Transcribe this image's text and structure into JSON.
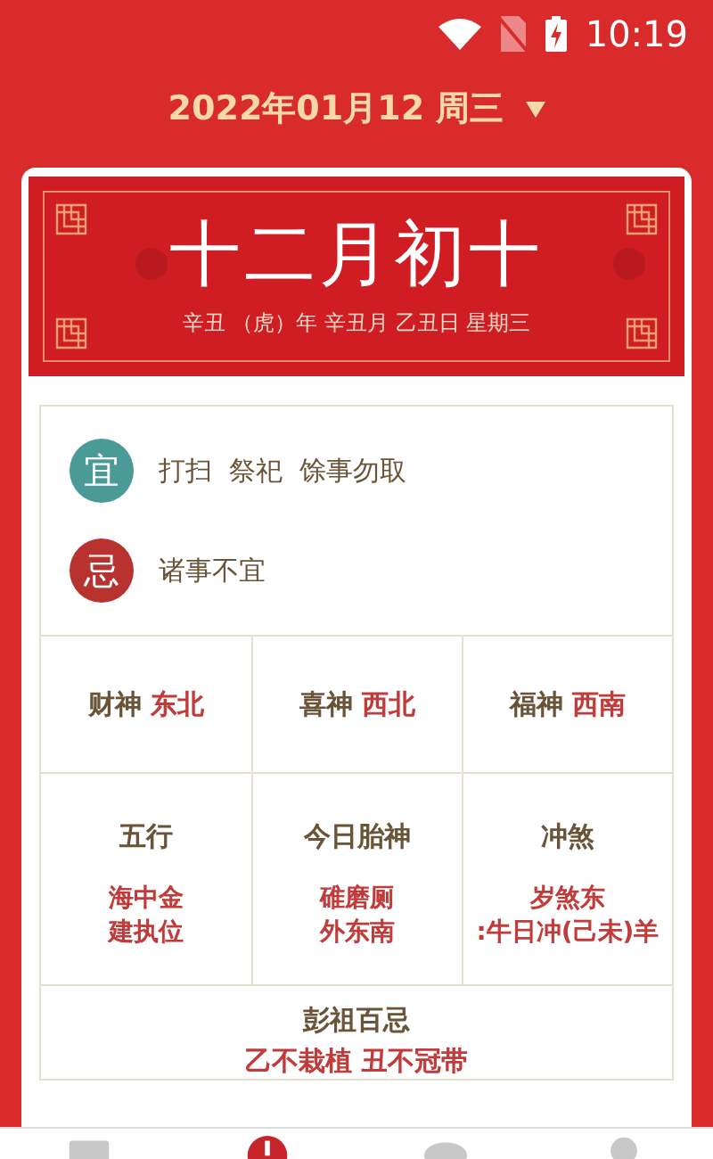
{
  "status_bar": {
    "time": "10:19"
  },
  "date_picker": {
    "label": "2022年01月12 周三"
  },
  "lunar": {
    "date": "十二月初十",
    "detail": "辛丑 （虎）年 辛丑月 乙丑日 星期三"
  },
  "yi_ji": [
    {
      "kind": "yi",
      "badge": "宜",
      "text": "打扫  祭祀  馀事勿取"
    },
    {
      "kind": "ji",
      "badge": "忌",
      "text": "诸事不宜"
    }
  ],
  "gods": [
    {
      "label": "财神",
      "value": "东北"
    },
    {
      "label": "喜神",
      "value": "西北"
    },
    {
      "label": "福神",
      "value": "西南"
    }
  ],
  "details": [
    {
      "title": "五行",
      "lines": [
        "海中金",
        "建执位"
      ]
    },
    {
      "title": "今日胎神",
      "lines": [
        "碓磨厕",
        "外东南"
      ]
    },
    {
      "title": "冲煞",
      "lines": [
        "岁煞东",
        ":牛日冲(己未)羊"
      ]
    }
  ],
  "pengzu": {
    "title": "彭祖百忌",
    "text": "乙不栽植 丑不冠带"
  },
  "bottom_nav": [
    {
      "kind": "calendar",
      "selected": false
    },
    {
      "kind": "almanac",
      "selected": true
    },
    {
      "kind": "weather",
      "selected": false
    },
    {
      "kind": "profile",
      "selected": false
    }
  ]
}
